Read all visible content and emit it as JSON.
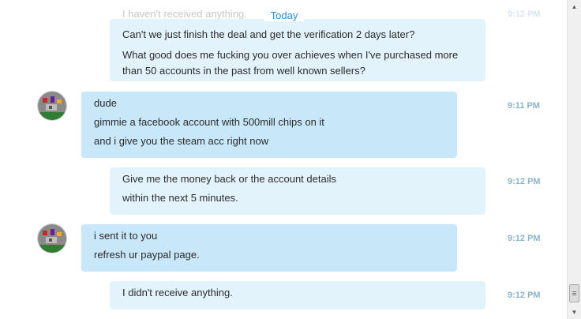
{
  "header": {
    "today_label": "Today",
    "ghost_text": "I haven't received anything.",
    "ghost_time": "9:12 PM"
  },
  "messages": [
    {
      "direction": "out",
      "lines": [
        "Can't we just finish the deal and get the verification 2 days later?",
        "What good does me fucking you over achieves when I've purchased more than 50 accounts in the past from well known sellers?"
      ],
      "time": ""
    },
    {
      "direction": "in",
      "lines": [
        "dude",
        "gimmie a facebook account with 500mill chips on it",
        "and i give you the steam acc right now"
      ],
      "time": "9:11 PM"
    },
    {
      "direction": "out",
      "lines": [
        "Give me the money back or the account details",
        "within the next 5 minutes."
      ],
      "time": "9:12 PM"
    },
    {
      "direction": "in",
      "lines": [
        "i sent it to you",
        "refresh ur paypal page."
      ],
      "time": "9:12 PM"
    },
    {
      "direction": "out",
      "lines": [
        "I didn't receive anything."
      ],
      "time": "9:12 PM"
    }
  ],
  "colors": {
    "incoming_bubble": "#c8e8fa",
    "outgoing_bubble": "#e3f3fc",
    "time_text": "#8ab4cc",
    "today_text": "#2a8ed0"
  }
}
